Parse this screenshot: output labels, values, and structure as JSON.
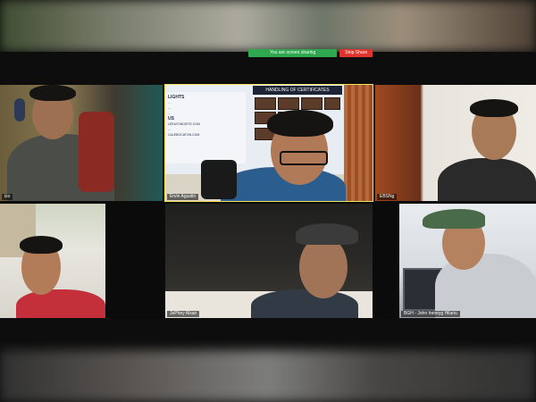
{
  "share_bar": {
    "status_text": "You are screen sharing",
    "stop_label": "Stop Share"
  },
  "participants": [
    {
      "name": "izo",
      "active": false
    },
    {
      "name": "Ervin Agustin",
      "active": true
    },
    {
      "name": "EBSNg",
      "active": false
    },
    {
      "name": "",
      "active": false
    },
    {
      "name": "JePhey Alsan",
      "active": false
    },
    {
      "name": "BGH - John Ireneyg Hilariu",
      "active": false
    }
  ],
  "board": {
    "title": "HANDLING OF CERTIFICATES",
    "left_lines": [
      "LIGHTS",
      "...",
      "...",
      "...",
      "US",
      "LEEAYONGSITE.COM",
      "...",
      "CALEBOCATON.COM"
    ]
  },
  "colors": {
    "active_border": "#f2e45b",
    "share_green": "#2fa84f",
    "stop_red": "#e0342f"
  }
}
